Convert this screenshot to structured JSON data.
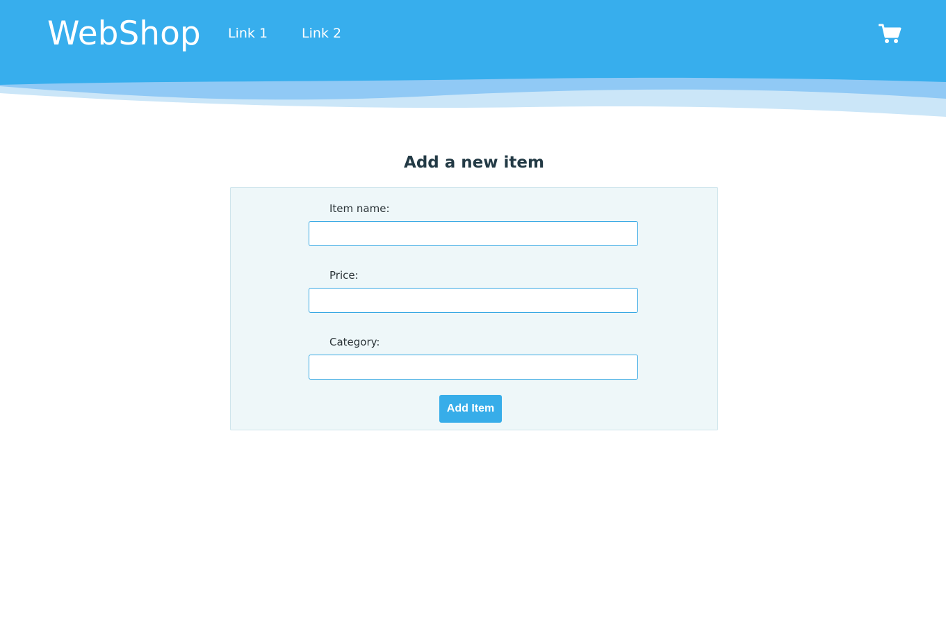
{
  "header": {
    "brand": "WebShop",
    "nav": [
      {
        "label": "Link 1"
      },
      {
        "label": "Link 2"
      }
    ],
    "cart_icon": "shopping-cart-icon"
  },
  "main": {
    "title": "Add a new item",
    "form": {
      "fields": [
        {
          "label": "Item name:",
          "value": "",
          "placeholder": ""
        },
        {
          "label": "Price:",
          "value": "",
          "placeholder": ""
        },
        {
          "label": "Category:",
          "value": "",
          "placeholder": ""
        }
      ],
      "submit_label": "Add Item"
    }
  },
  "colors": {
    "header_primary": "#37aeed",
    "wave_mid": "#90c9f5",
    "wave_light": "#cbe6f8",
    "accent": "#37ade9",
    "card_background": "#eef7f9",
    "title_text": "#233a45"
  }
}
